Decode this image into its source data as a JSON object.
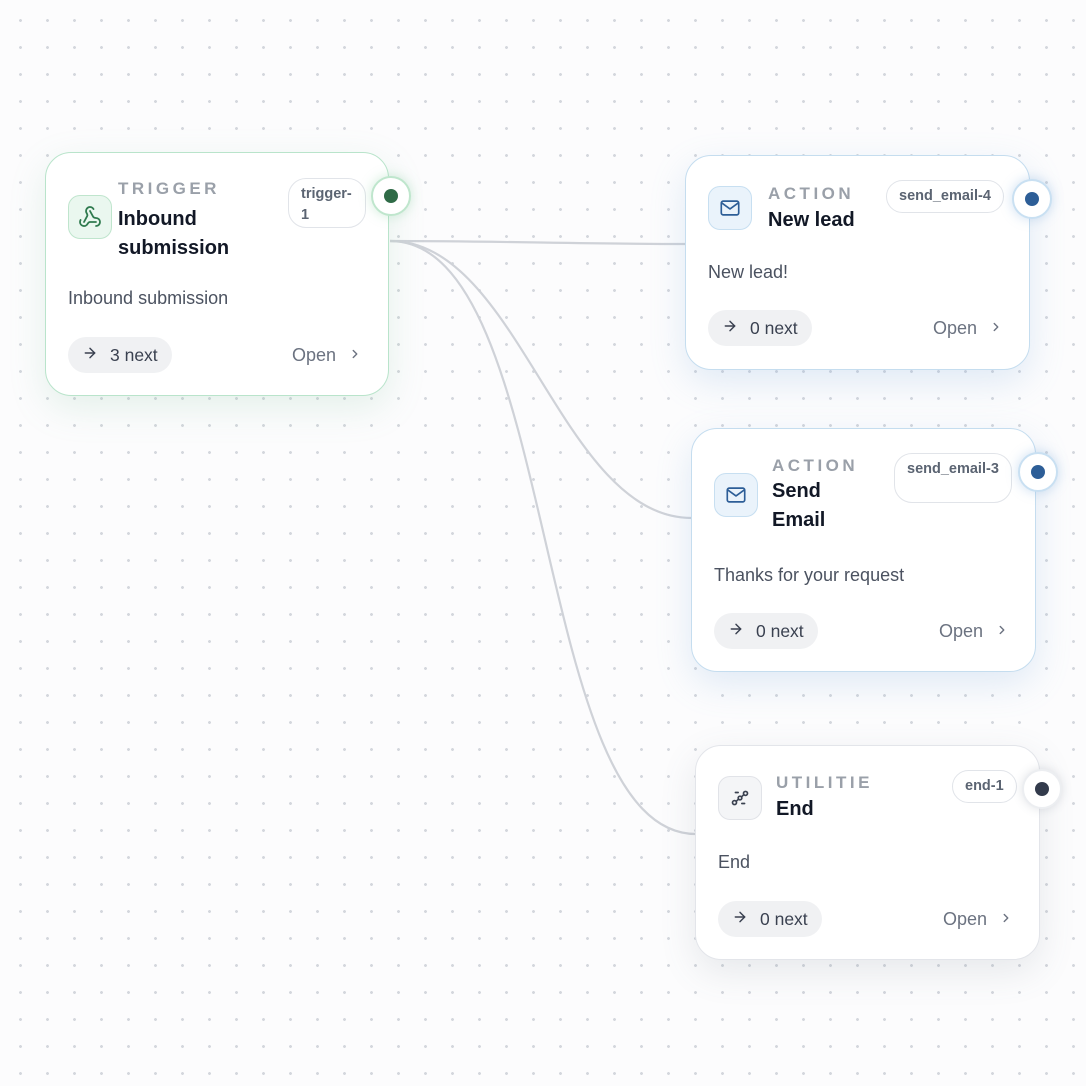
{
  "colors": {
    "trigger_accent": "#2f6b47",
    "action_accent": "#2d5e97",
    "utility_accent": "#333b4c",
    "edge": "#cfd2d8"
  },
  "nodes": [
    {
      "id": "trigger-1",
      "kind": "TRIGGER",
      "title": "Inbound submission",
      "tag": "trigger-1",
      "description": "Inbound submission",
      "next": "3 next",
      "open": "Open",
      "icon": "webhook-icon"
    },
    {
      "id": "send_email-4",
      "kind": "ACTION",
      "title": "New lead",
      "tag": "send_email-4",
      "description": "New lead!",
      "next": "0 next",
      "open": "Open",
      "icon": "mail-icon"
    },
    {
      "id": "send_email-3",
      "kind": "ACTION",
      "title": "Send Email",
      "tag": "send_email-3",
      "description": "Thanks for your request",
      "next": "0 next",
      "open": "Open",
      "icon": "mail-icon"
    },
    {
      "id": "end-1",
      "kind": "UTILITIE",
      "title": "End",
      "tag": "end-1",
      "description": "End",
      "next": "0 next",
      "open": "Open",
      "icon": "route-icon"
    }
  ],
  "edges": [
    {
      "from": "trigger-1",
      "to": "send_email-4"
    },
    {
      "from": "trigger-1",
      "to": "send_email-3"
    },
    {
      "from": "trigger-1",
      "to": "end-1"
    }
  ]
}
